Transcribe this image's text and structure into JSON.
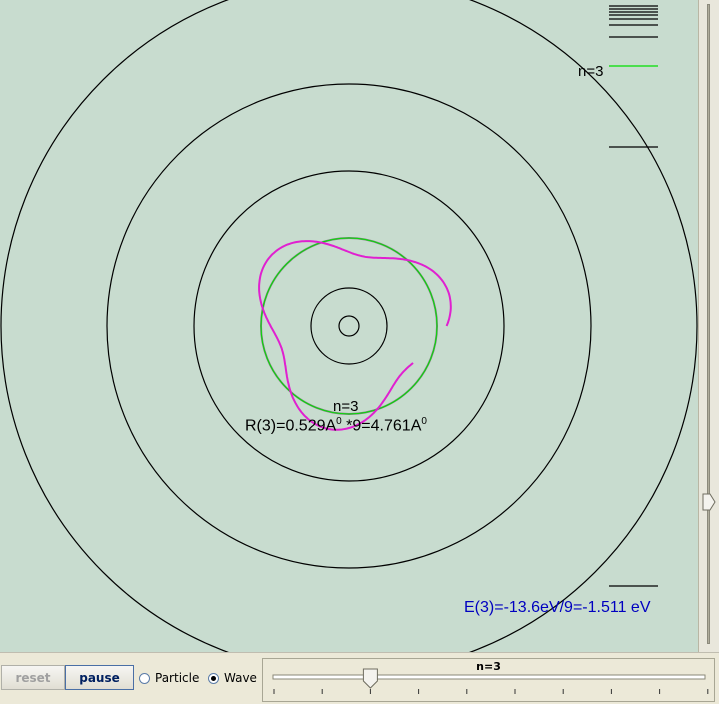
{
  "simulation": {
    "level_label": "n=3",
    "orbit_label": "n=3",
    "radius_label": "R(3)=0.529A",
    "radius_sup1": "0",
    "radius_mid": " *9=4.761A",
    "radius_sup2": "0",
    "energy_label": "E(3)=-13.6eV/9=-1.511 eV",
    "colors": {
      "background": "#c8dccf",
      "orbit": "#000000",
      "current_orbit": "#808080",
      "wave": "#e020d0",
      "mean_circle": "#00e000",
      "energy_text": "#0000c0"
    }
  },
  "controls": {
    "reset_label": "reset",
    "pause_label": "pause",
    "particle_label": "Particle",
    "wave_label": "Wave",
    "selected_mode": "Wave",
    "slider_title": "n=3",
    "slider_value": 3
  }
}
